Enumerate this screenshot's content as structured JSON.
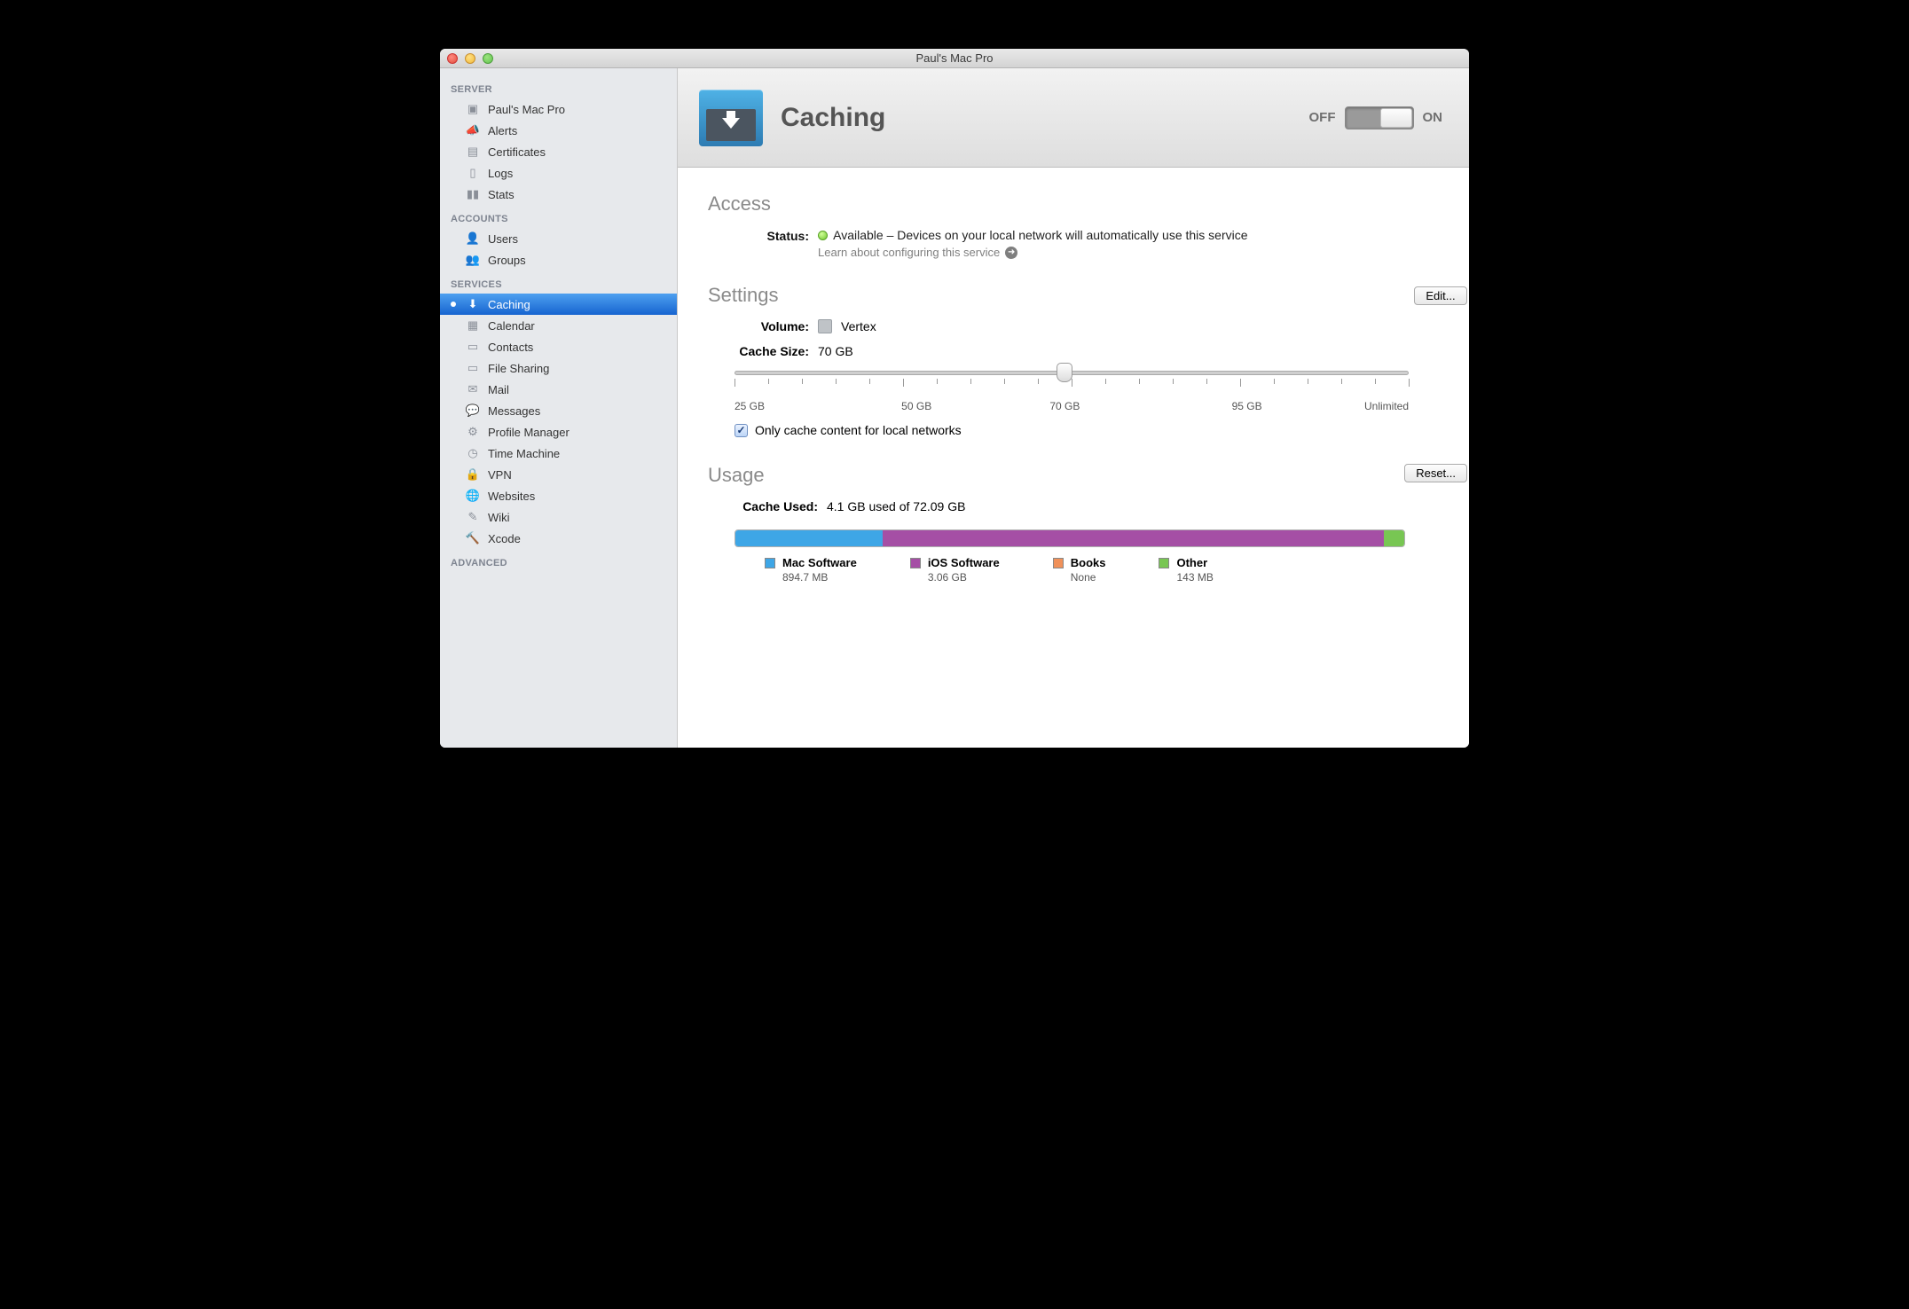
{
  "window": {
    "title": "Paul's Mac Pro"
  },
  "sidebar": {
    "sections": {
      "server": "SERVER",
      "accounts": "ACCOUNTS",
      "services": "SERVICES",
      "advanced": "ADVANCED"
    },
    "server": [
      {
        "label": "Paul's Mac Pro"
      },
      {
        "label": "Alerts"
      },
      {
        "label": "Certificates"
      },
      {
        "label": "Logs"
      },
      {
        "label": "Stats"
      }
    ],
    "accounts": [
      {
        "label": "Users"
      },
      {
        "label": "Groups"
      }
    ],
    "services": [
      {
        "label": "Caching"
      },
      {
        "label": "Calendar"
      },
      {
        "label": "Contacts"
      },
      {
        "label": "File Sharing"
      },
      {
        "label": "Mail"
      },
      {
        "label": "Messages"
      },
      {
        "label": "Profile Manager"
      },
      {
        "label": "Time Machine"
      },
      {
        "label": "VPN"
      },
      {
        "label": "Websites"
      },
      {
        "label": "Wiki"
      },
      {
        "label": "Xcode"
      }
    ]
  },
  "header": {
    "title": "Caching",
    "off": "OFF",
    "on": "ON",
    "state": "on"
  },
  "access": {
    "section": "Access",
    "status_label": "Status:",
    "status_text": "Available – Devices on your local network will automatically use this service",
    "learn": "Learn about configuring this service"
  },
  "settings": {
    "section": "Settings",
    "volume_label": "Volume:",
    "volume_value": "Vertex",
    "edit": "Edit...",
    "cache_size_label": "Cache Size:",
    "cache_size_value": "70 GB",
    "slider": {
      "min_label": "25 GB",
      "q2_label": "50 GB",
      "q3_label": "70 GB",
      "q4_label": "95 GB",
      "max_label": "Unlimited",
      "percent": 49
    },
    "checkbox_label": "Only cache content for local networks",
    "checkbox_checked": true
  },
  "usage": {
    "section": "Usage",
    "used_label": "Cache Used:",
    "used_value": "4.1 GB used of 72.09 GB",
    "reset": "Reset...",
    "segments": [
      {
        "name": "Mac Software",
        "value": "894.7 MB",
        "color": "#3ea6e6",
        "percent": 22
      },
      {
        "name": "iOS Software",
        "value": "3.06 GB",
        "color": "#a54fa5",
        "percent": 75
      },
      {
        "name": "Books",
        "value": "None",
        "color": "#f0915a",
        "percent": 0
      },
      {
        "name": "Other",
        "value": "143 MB",
        "color": "#78c653",
        "percent": 3
      }
    ]
  }
}
